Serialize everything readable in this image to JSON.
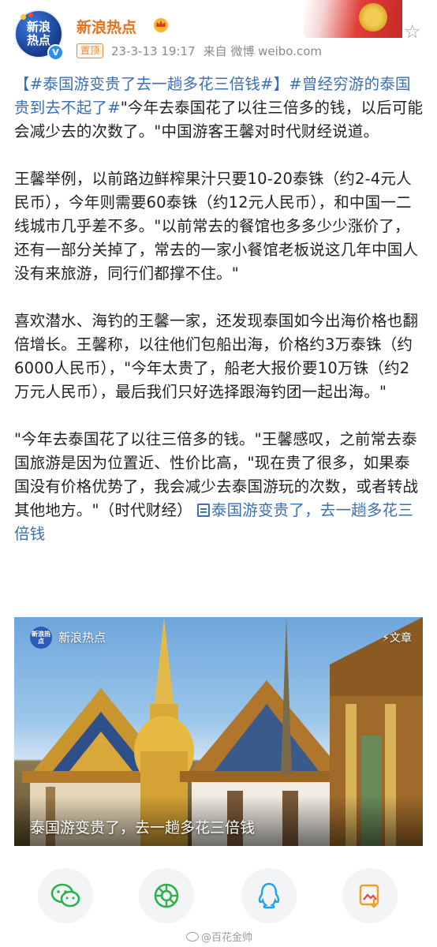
{
  "header": {
    "avatar_text_line1": "新浪",
    "avatar_text_line2": "热点",
    "username": "新浪热点",
    "pinned_label": "置顶",
    "timestamp": "23-3-13 19:17",
    "source": "来自 微博 weibo.com",
    "favorite_icon": "star-icon"
  },
  "post": {
    "tag1": "【#泰国游变贵了去一趟多花三倍钱#】",
    "tag2": "#曾经穷游的泰国贵到去不起了#",
    "p1_rest": "\"今年去泰国花了以往三倍多的钱，以后可能会减少去的次数了。\"中国游客王馨对时代财经说道。",
    "p2": "王馨举例，以前路边鲜榨果汁只要10-20泰铢（约2-4元人民币），今年则需要60泰铢（约12元人民币），和中国一二线城市几乎差不多。\"以前常去的餐馆也多多少少涨价了，还有一部分关掉了，常去的一家小餐馆老板说这几年中国人没有来旅游，同行们都撑不住。\"",
    "p3": "喜欢潜水、海钓的王馨一家，还发现泰国如今出海价格也翻倍增长。王馨称，以往他们包船出海，价格约3万泰铢（约6000人民币），\"今年太贵了，船老大报价要10万铢（约2万元人民币），最后我们只好选择跟海钓团一起出海。\"",
    "p4": "\"今年去泰国花了以往三倍多的钱。\"王馨感叹，之前常去泰国旅游是因为位置近、性价比高，\"现在贵了很多，如果泰国没有价格优势了，我会减少去泰国游玩的次数，或者转战其他地方。\"（时代财经）",
    "link_text": "泰国游变贵了，去一趟多花三倍钱"
  },
  "media": {
    "logo_text": "新浪热点",
    "source_name": "新浪热点",
    "article_badge": "⚡文章",
    "caption": "泰国游变贵了，去一趟多花三倍钱"
  },
  "share": {
    "buttons": [
      "wechat-icon",
      "moments-icon",
      "qq-icon",
      "save-image-icon"
    ]
  },
  "watermark": "@百花金帅"
}
